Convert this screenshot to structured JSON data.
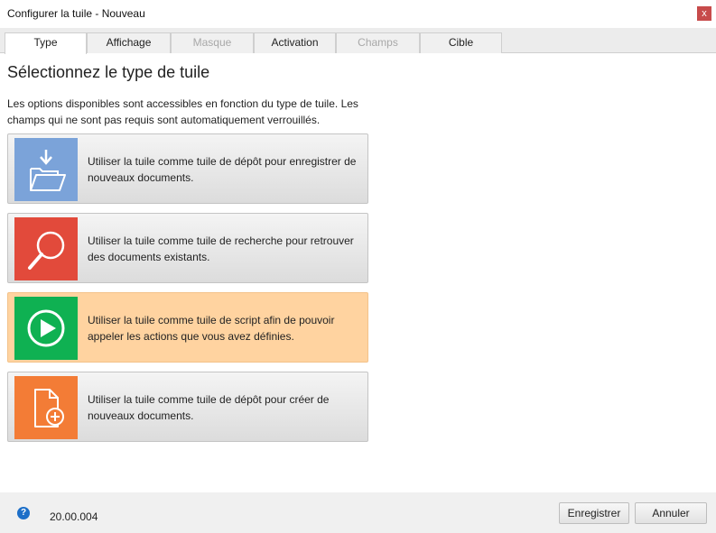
{
  "window": {
    "title": "Configurer la tuile - Nouveau",
    "close_glyph": "x"
  },
  "tabs": [
    {
      "label": "Type",
      "state": "active"
    },
    {
      "label": "Affichage",
      "state": "normal"
    },
    {
      "label": "Masque",
      "state": "disabled"
    },
    {
      "label": "Activation",
      "state": "normal"
    },
    {
      "label": "Champs",
      "state": "disabled"
    },
    {
      "label": "Cible",
      "state": "normal"
    }
  ],
  "main": {
    "heading": "Sélectionnez le type de tuile",
    "description": "Les options disponibles sont accessibles en fonction du type de tuile. Les champs qui ne sont pas requis sont automatiquement verrouillés.",
    "options": [
      {
        "icon": "folder-download-icon",
        "color": "#7ba3d9",
        "text": "Utiliser la tuile comme tuile de dépôt pour enregistrer de nouveaux documents.",
        "selected": false
      },
      {
        "icon": "search-icon",
        "color": "#e24a3b",
        "text": "Utiliser la tuile comme tuile de recherche pour retrouver des documents existants.",
        "selected": false
      },
      {
        "icon": "play-circle-icon",
        "color": "#0fb152",
        "text": "Utiliser la tuile comme tuile de script afin de pouvoir appeler les actions que vous avez définies.",
        "selected": true
      },
      {
        "icon": "document-add-icon",
        "color": "#f37c36",
        "text": "Utiliser la tuile comme tuile de dépôt pour créer de nouveaux documents.",
        "selected": false
      }
    ]
  },
  "footer": {
    "help_glyph": "?",
    "version": "20.00.004",
    "save_label": "Enregistrer",
    "cancel_label": "Annuler"
  }
}
